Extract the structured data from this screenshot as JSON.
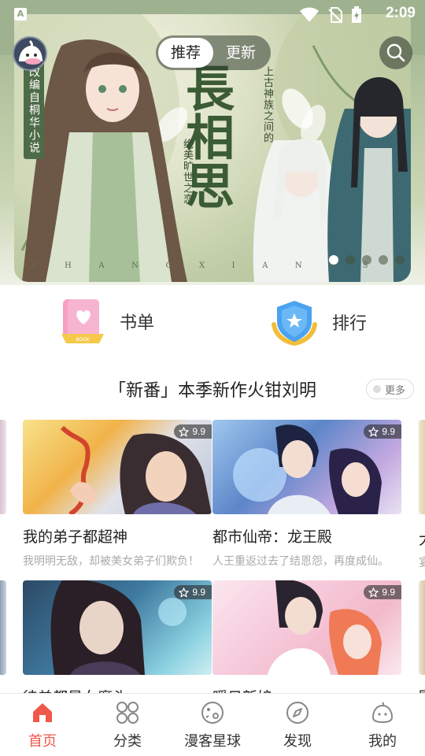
{
  "status": {
    "time": "2:09",
    "app_badge": "A"
  },
  "header": {
    "tabs": [
      {
        "label": "推荐",
        "active": true
      },
      {
        "label": "更新",
        "active": false
      }
    ]
  },
  "banner": {
    "side_tag": "改编自桐华小说",
    "title": "長相思",
    "tagline_1": "上古神族之间的",
    "tagline_2": "绝美旷世之恋",
    "pinyin": [
      "C",
      "H",
      "A",
      "N",
      "G",
      "X",
      "I",
      "A",
      "N",
      "G",
      "S",
      "I"
    ],
    "dots": 5,
    "active_dot": 0
  },
  "quick_menu": [
    {
      "label": "书单",
      "icon": "booklist-icon"
    },
    {
      "label": "排行",
      "icon": "ranking-shield-icon"
    }
  ],
  "section": {
    "title": "「新番」本季新作火钳刘明",
    "more_label": "更多"
  },
  "cards": [
    {
      "title": "我的弟子都超神",
      "subtitle": "我明明无敌，却被美女弟子们欺负！",
      "rating": "9.9"
    },
    {
      "title": "都市仙帝：龙王殿",
      "subtitle": "人王重返过去了结恩怨，再度成仙。",
      "rating": "9.9"
    },
    {
      "title": "徒弟都是女魔头",
      "subtitle": "",
      "rating": "9.9"
    },
    {
      "title": "暖日新娘",
      "subtitle": "",
      "rating": "9.9"
    }
  ],
  "edge_peek": {
    "title_char": "大",
    "sub_char": "宴",
    "bottom_char": "寄"
  },
  "bottom_nav": [
    {
      "label": "首页",
      "icon": "home-icon",
      "active": true
    },
    {
      "label": "分类",
      "icon": "category-grid-icon",
      "active": false
    },
    {
      "label": "漫客星球",
      "icon": "planet-icon",
      "active": false
    },
    {
      "label": "发现",
      "icon": "compass-icon",
      "active": false
    },
    {
      "label": "我的",
      "icon": "profile-face-icon",
      "active": false
    }
  ],
  "colors": {
    "accent": "#f0584c",
    "banner_green": "#9fb28f",
    "title_green": "#3b5b35"
  }
}
